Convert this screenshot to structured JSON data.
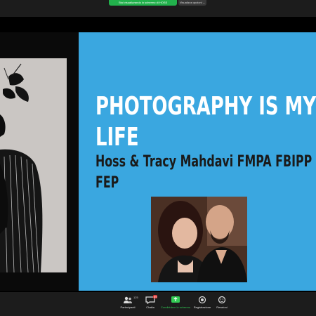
{
  "window": {
    "share_banner": "Stai visualizzando lo schermo di HOSS",
    "view_options": "Visualizza opzioni ⌄"
  },
  "slide": {
    "title_line1": "PHOTOGRAPHY IS MY",
    "title_line2": "LIFE",
    "subtitle_line1": "Hoss & Tracy Mahdavi FMPA FBIPP",
    "subtitle_line2": "FEP",
    "accent_color": "#3aa7e0"
  },
  "toolbar": {
    "participants": {
      "label": "Partecipanti",
      "count": "125",
      "icon": "people-icon"
    },
    "chat": {
      "label": "Chatta",
      "badge": "89",
      "icon": "chat-icon"
    },
    "share_screen": {
      "label": "Condividere lo schermo",
      "icon": "share-screen-icon",
      "color": "#33cc55"
    },
    "record": {
      "label": "Registrazione",
      "icon": "record-icon"
    },
    "reactions": {
      "label": "Reazioni",
      "icon": "reaction-icon"
    }
  }
}
